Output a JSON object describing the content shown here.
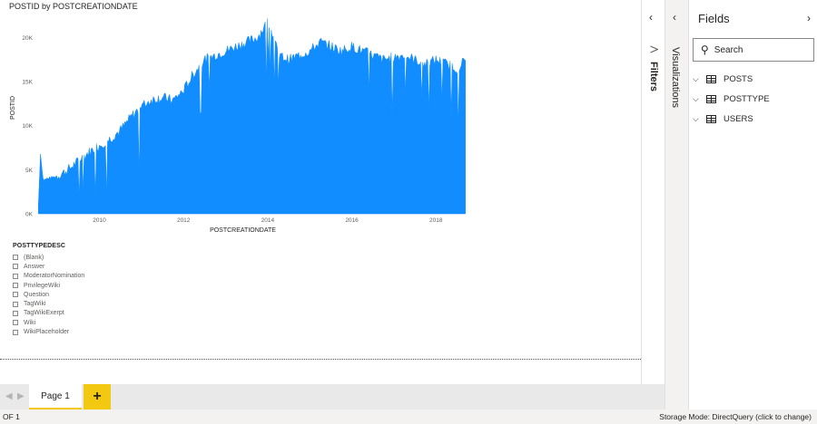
{
  "visual": {
    "title": "POSTID by POSTCREATIONDATE"
  },
  "chart_data": {
    "type": "area",
    "xlabel": "POSTCREATIONDATE",
    "ylabel": "POSTID",
    "x_ticks": [
      "2010",
      "2012",
      "2014",
      "2016",
      "2018"
    ],
    "y_ticks": [
      "0K",
      "5K",
      "10K",
      "15K",
      "20K"
    ],
    "ylim": [
      0,
      22000
    ],
    "xlim": [
      2008.5,
      2018.75
    ],
    "color": "#118dff",
    "grid": false,
    "x": [
      2008.55,
      2008.6,
      2008.66,
      2008.75,
      2009.0,
      2009.25,
      2009.5,
      2009.75,
      2010.0,
      2010.25,
      2010.5,
      2010.75,
      2011.0,
      2011.25,
      2011.5,
      2011.75,
      2012.0,
      2012.25,
      2012.5,
      2012.75,
      2013.0,
      2013.25,
      2013.5,
      2013.75,
      2014.0,
      2014.15,
      2014.25,
      2014.5,
      2014.75,
      2015.0,
      2015.25,
      2015.5,
      2015.75,
      2016.0,
      2016.25,
      2016.5,
      2016.75,
      2017.0,
      2017.25,
      2017.5,
      2017.75,
      2018.0,
      2018.25,
      2018.5,
      2018.7
    ],
    "y": [
      1000,
      7000,
      3800,
      4000,
      4300,
      5000,
      6000,
      7000,
      7800,
      8500,
      9500,
      11000,
      12200,
      13000,
      13200,
      12900,
      14000,
      16000,
      17500,
      18000,
      18500,
      19000,
      19500,
      20000,
      21800,
      20000,
      18000,
      17500,
      18000,
      18500,
      19500,
      19000,
      18500,
      19000,
      18500,
      18000,
      17500,
      17800,
      18000,
      17500,
      17000,
      17500,
      17000,
      16500,
      17500
    ]
  },
  "slicer": {
    "title": "POSTTYPEDESC",
    "items": [
      "(Blank)",
      "Answer",
      "ModeratorNomination",
      "PrivilegeWiki",
      "Question",
      "TagWiki",
      "TagWikiExerpt",
      "Wiki",
      "WikiPlaceholder"
    ]
  },
  "pages": {
    "tabs": [
      "Page 1"
    ],
    "add_label": "+",
    "prev_glyph": "◀",
    "next_glyph": "▶"
  },
  "status": {
    "page_info": "OF 1",
    "storage_mode": "Storage Mode: DirectQuery (click to change)"
  },
  "filters": {
    "label": "Filters",
    "collapse_glyph": "‹"
  },
  "visualizations": {
    "label": "Visualizations",
    "collapse_glyph": "‹"
  },
  "fields": {
    "title": "Fields",
    "expand_glyph": "›",
    "search_placeholder": "Search",
    "tables": [
      "POSTS",
      "POSTTYPE",
      "USERS"
    ]
  },
  "icons": {
    "search": "search-icon",
    "filter": "filter-icon",
    "table": "table-icon",
    "chevron": "chevron-icon"
  }
}
